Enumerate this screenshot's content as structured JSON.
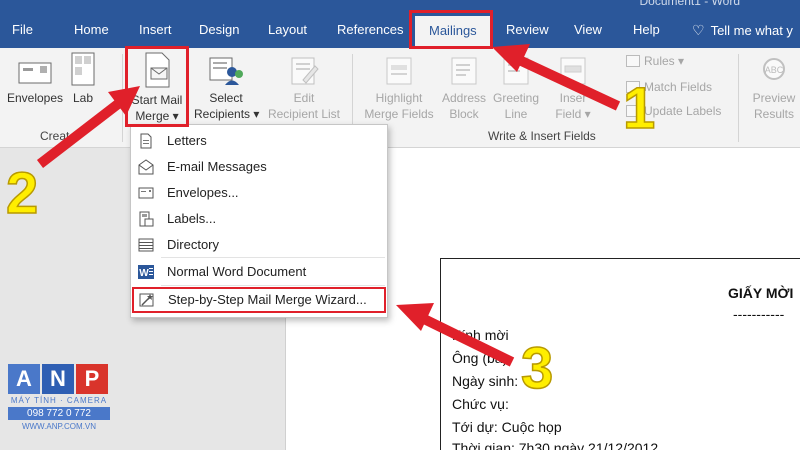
{
  "window": {
    "title": "Document1 - Word"
  },
  "tabs": [
    {
      "label": "File"
    },
    {
      "label": "Home"
    },
    {
      "label": "Insert"
    },
    {
      "label": "Design"
    },
    {
      "label": "Layout"
    },
    {
      "label": "References"
    },
    {
      "label": "Mailings"
    },
    {
      "label": "Review"
    },
    {
      "label": "View"
    },
    {
      "label": "Help"
    }
  ],
  "tell_me": "Tell me what y",
  "ribbon": {
    "create": {
      "group_label": "Creat",
      "envelopes": "Envelopes",
      "labels": "Lab"
    },
    "start": {
      "start_line1": "Start Mail",
      "start_line2": "Merge",
      "select_line1": "Select",
      "select_line2": "Recipients",
      "edit_line1": "Edit",
      "edit_line2": "Recipient List"
    },
    "write": {
      "group_label": "Write & Insert Fields",
      "highlight_line1": "Highlight",
      "highlight_line2": "Merge Fields",
      "address_line1": "Address",
      "address_line2": "Block",
      "greeting_line1": "Greeting",
      "greeting_line2": "Line",
      "insert_line1": "Inser",
      "insert_line2": "Field",
      "rules": "Rules",
      "match": "Match Fields",
      "update": "Update Labels"
    },
    "preview": {
      "line1": "Preview",
      "line2": "Results"
    }
  },
  "menu": {
    "items": [
      {
        "label": "Letters",
        "icon": "letter-icon"
      },
      {
        "label": "E-mail Messages",
        "icon": "email-icon"
      },
      {
        "label": "Envelopes...",
        "icon": "envelope-icon"
      },
      {
        "label": "Labels...",
        "icon": "labels-icon"
      },
      {
        "label": "Directory",
        "icon": "directory-icon"
      },
      {
        "label": "Normal Word Document",
        "icon": "word-icon"
      },
      {
        "label": "Step-by-Step Mail Merge Wizard...",
        "icon": "wizard-icon"
      }
    ]
  },
  "document": {
    "title": "GIẤY MỜI",
    "dashes": "-----------",
    "lines": [
      "Kính mời",
      "Ông (bà):",
      "Ngày sinh:",
      "Chức vụ:",
      "Tới dự: Cuộc họp",
      "Thời gian: 7h30 ngày 21/12/2012"
    ]
  },
  "annotations": {
    "step1": "1",
    "step2": "2",
    "step3": "3"
  },
  "watermark": {
    "letters": [
      "A",
      "N",
      "P"
    ],
    "tagline": "MÁY TÍNH · CAMERA",
    "phone": "098 772 0 772",
    "url": "WWW.ANP.COM.VN"
  },
  "colors": {
    "tab_bar": "#2b579a",
    "highlight": "#e0202a",
    "annotation_number": "#ffee00",
    "logo_a": "#4a78c9",
    "logo_n": "#2f5fb3",
    "logo_p": "#d9342b"
  }
}
